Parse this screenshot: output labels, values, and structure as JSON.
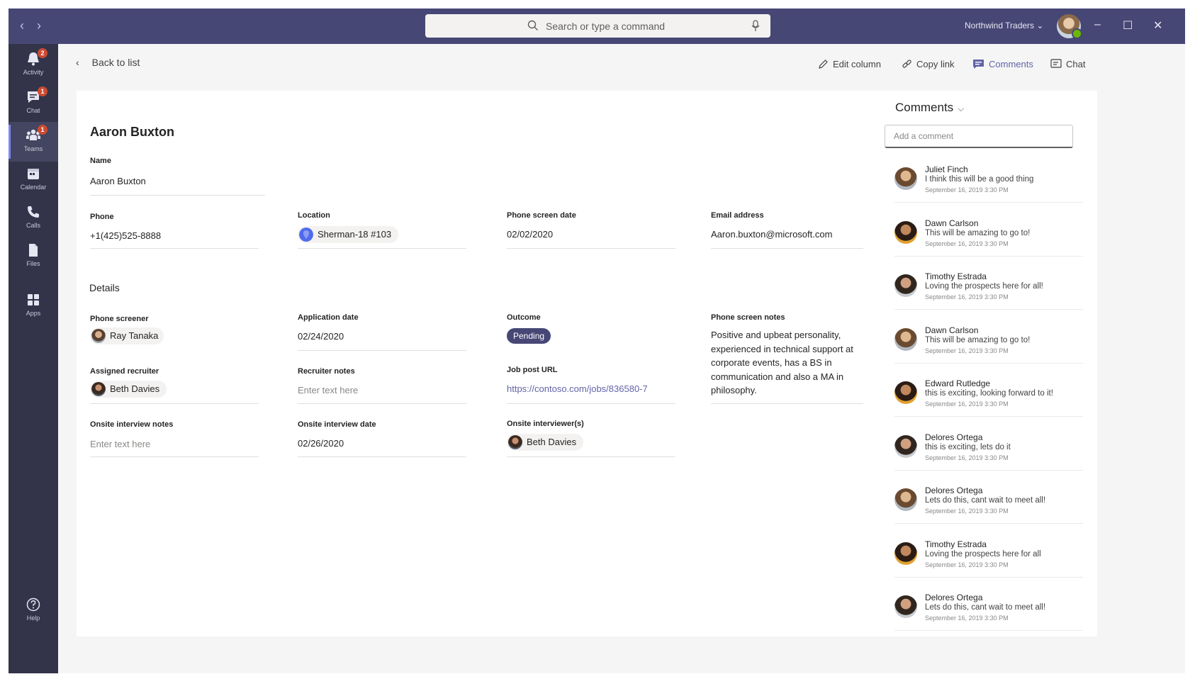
{
  "titlebar": {
    "search_placeholder": "Search or type a command",
    "org_name": "Northwind Traders ⌄",
    "window_controls": [
      "–",
      "☐",
      "✕"
    ]
  },
  "rail": {
    "items": [
      {
        "label": "Activity",
        "icon": "bell-icon",
        "badge": "2"
      },
      {
        "label": "Chat",
        "icon": "chat-icon",
        "badge": "1"
      },
      {
        "label": "Teams",
        "icon": "teams-icon",
        "badge": "1",
        "active": true
      },
      {
        "label": "Calendar",
        "icon": "calendar-icon"
      },
      {
        "label": "Calls",
        "icon": "phone-icon"
      },
      {
        "label": "Files",
        "icon": "files-icon"
      },
      {
        "label": "Apps",
        "icon": "apps-icon"
      },
      {
        "label": "Help",
        "icon": "help-icon"
      }
    ]
  },
  "header": {
    "back_label": "Back to list",
    "actions": [
      {
        "label": "Edit column",
        "icon": "pencil-icon"
      },
      {
        "label": "Copy link",
        "icon": "link-icon"
      },
      {
        "label": "Comments",
        "icon": "comment-icon",
        "active": true
      },
      {
        "label": "Chat",
        "icon": "chat-outline-icon"
      }
    ]
  },
  "record": {
    "title": "Aaron Buxton",
    "name": {
      "label": "Name",
      "value": "Aaron Buxton"
    },
    "phone": {
      "label": "Phone",
      "value": "+1(425)525-8888"
    },
    "location": {
      "label": "Location",
      "value": "Sherman-18 #103"
    },
    "phone_screen_date": {
      "label": "Phone screen date",
      "value": "02/02/2020"
    },
    "email": {
      "label": "Email address",
      "value": "Aaron.buxton@microsoft.com"
    },
    "details_heading": "Details",
    "phone_screener": {
      "label": "Phone screener",
      "value": "Ray Tanaka"
    },
    "application_date": {
      "label": "Application date",
      "value": "02/24/2020"
    },
    "outcome": {
      "label": "Outcome",
      "value": "Pending"
    },
    "phone_screen_notes": {
      "label": "Phone screen notes",
      "value": "Positive and upbeat personality, experienced in technical support at corporate events, has a BS in communication and also a MA in philosophy."
    },
    "assigned_recruiter": {
      "label": "Assigned recruiter",
      "value": "Beth Davies"
    },
    "recruiter_notes": {
      "label": "Recruiter notes",
      "placeholder": "Enter text here"
    },
    "job_post_url": {
      "label": "Job post URL",
      "value": "https://contoso.com/jobs/836580-7"
    },
    "onsite_interview_notes": {
      "label": "Onsite interview notes",
      "placeholder": "Enter text here"
    },
    "onsite_interview_date": {
      "label": "Onsite interview date",
      "value": "02/26/2020"
    },
    "onsite_interviewers": {
      "label": "Onsite interviewer(s)",
      "value": "Beth Davies"
    }
  },
  "comments": {
    "title": "Comments",
    "input_placeholder": "Add a comment",
    "items": [
      {
        "name": "Juliet Finch",
        "text": "I think this will be a good thing",
        "date": "September 16, 2019 3:30 PM"
      },
      {
        "name": "Dawn Carlson",
        "text": "This will be amazing to go to!",
        "date": "September 16, 2019 3:30 PM"
      },
      {
        "name": "Timothy Estrada",
        "text": "Loving the prospects here for all!",
        "date": "September 16, 2019 3:30 PM"
      },
      {
        "name": "Dawn Carlson",
        "text": "This will be amazing to go to!",
        "date": "September 16, 2019 3:30 PM"
      },
      {
        "name": "Edward Rutledge",
        "text": "this is exciting, looking forward to it!",
        "date": "September 16, 2019 3:30 PM"
      },
      {
        "name": "Delores Ortega",
        "text": "this is exciting, lets do it",
        "date": "September 16, 2019 3:30 PM"
      },
      {
        "name": "Delores Ortega",
        "text": "Lets do this, cant wait to meet all!",
        "date": "September 16, 2019 3:30 PM"
      },
      {
        "name": "Timothy Estrada",
        "text": "Loving the prospects here for all",
        "date": "September 16, 2019 3:30 PM"
      },
      {
        "name": "Delores Ortega",
        "text": "Lets do this, cant wait to meet all!",
        "date": "September 16, 2019 3:30 PM"
      }
    ]
  },
  "colors": {
    "titlebar": "#464775",
    "rail": "#33344a",
    "accent": "#6264a7",
    "badge": "#cc4a31"
  }
}
